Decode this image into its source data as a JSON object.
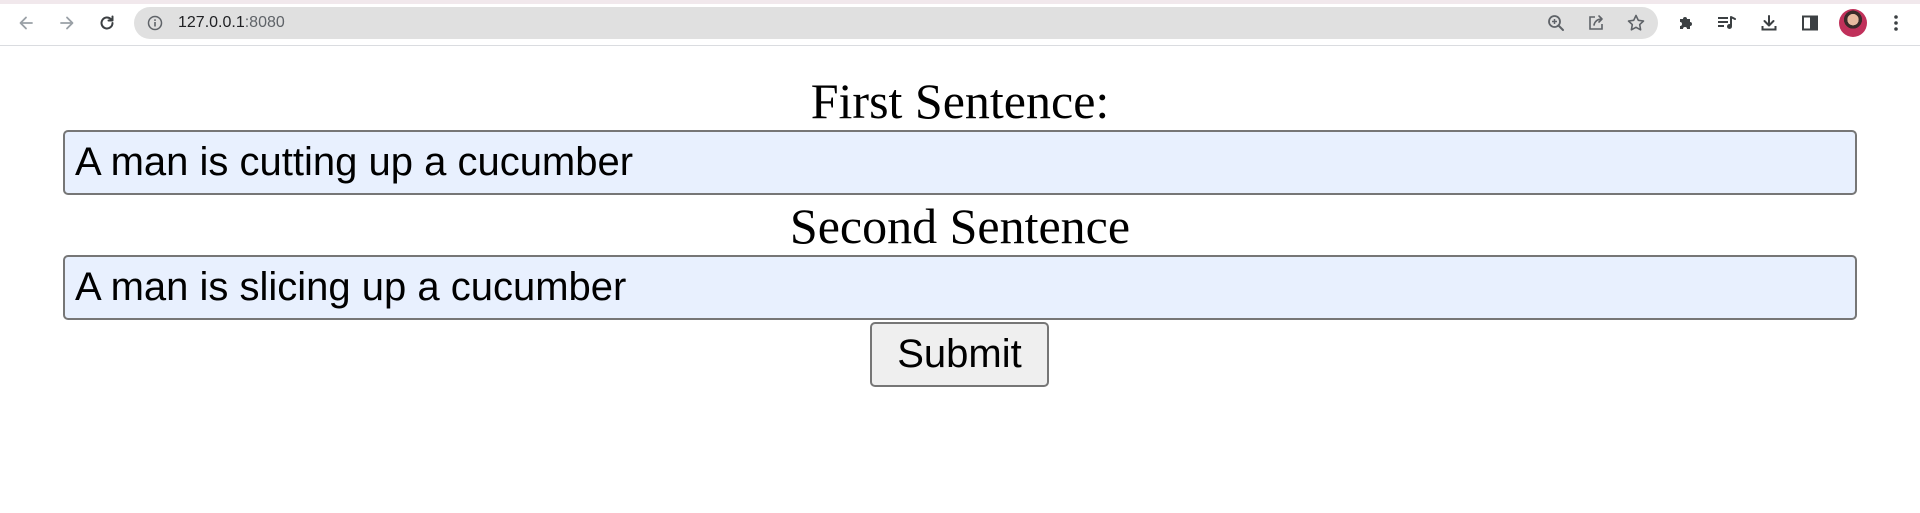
{
  "browser": {
    "url_host": "127.0.0.1",
    "url_port": ":8080",
    "icons": {
      "back": "arrow-left",
      "forward": "arrow-right",
      "reload": "reload",
      "info": "info-circle",
      "zoom": "magnifier-plus",
      "share": "share",
      "bookmark": "star",
      "extensions": "puzzle",
      "media": "media-queue",
      "download": "download",
      "side_panel": "side-panel",
      "menu": "three-dots"
    }
  },
  "form": {
    "first_label": "First Sentence:",
    "first_value": "A man is cutting up a cucumber",
    "second_label": "Second Sentence",
    "second_value": "A man is slicing up a cucumber",
    "submit_label": "Submit"
  },
  "colors": {
    "input_background": "#e8f0fe",
    "input_border": "#767676",
    "button_background": "#efefef",
    "omnibox_background": "#e0e0e0"
  }
}
